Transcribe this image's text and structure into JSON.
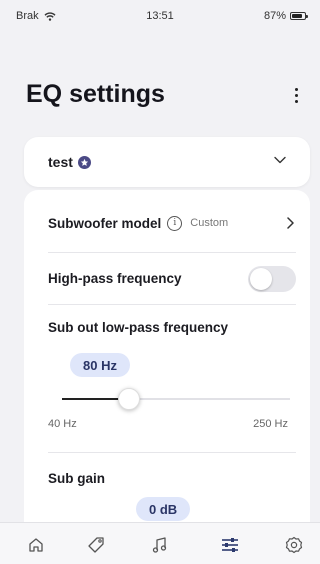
{
  "status_bar": {
    "carrier": "Brak",
    "time": "13:51",
    "battery": "87%",
    "battery_level": 0.87
  },
  "header": {
    "title": "EQ settings"
  },
  "preset": {
    "name": "test"
  },
  "subwoofer": {
    "label": "Subwoofer model",
    "value": "Custom"
  },
  "high_pass": {
    "label": "High-pass frequency",
    "enabled": false
  },
  "low_pass": {
    "label": "Sub out low-pass frequency",
    "value": "80 Hz",
    "value_hz": 80,
    "min_label": "40 Hz",
    "max_label": "250 Hz",
    "min_hz": 40,
    "max_hz": 250
  },
  "sub_gain": {
    "label": "Sub gain",
    "value": "0 dB"
  },
  "nav": {
    "items": [
      "home-icon",
      "tag-icon",
      "music-icon",
      "sliders-icon",
      "settings-icon"
    ],
    "active": "sliders-icon"
  },
  "colors": {
    "accent": "#2c3a6e",
    "pill_bg": "#dfe6fa",
    "badge": "#4b4a86"
  }
}
